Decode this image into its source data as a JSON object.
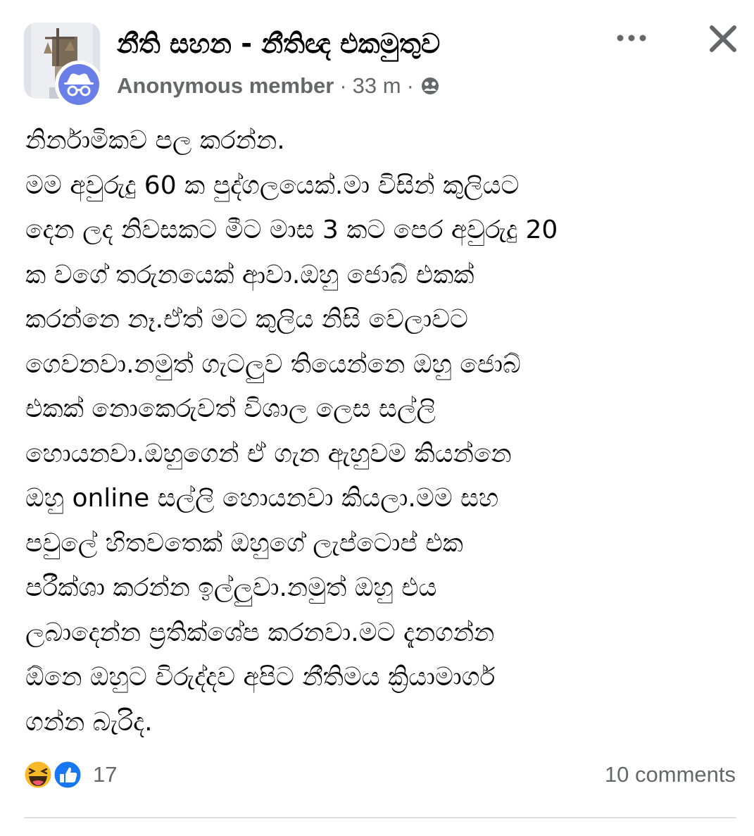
{
  "post": {
    "group_name": "නීති සහන -  නීතිඥ එකමුතුව",
    "author": "Anonymous member",
    "separator": "·",
    "time": "33 m",
    "body_lines": [
      "නිර්නාමිකව පල කරන්න.",
      "මම අවුරුදු 60 ක පුද්ගලයෙක්.මා විසින් කුලියට",
      "දෙන ලද නිවසකට මීට මාස 3 කට පෙර අවුරුදු 20",
      "ක වගේ තරුනයෙක් ආවා.ඔහු ජොබ් එකක්",
      "කරන්නෙ නෑ.ඒත් මට කුලිය නිසි වෙලාවට",
      "ගෙවනවා.නමුත් ගැටලුව තියෙන්නෙ ඔහු ජොබ්",
      "එකක් නොකෙරුවත් විශාල ලෙස සල්ලි",
      "හොයනවා.ඔහුගෙන් ඒ ගැන ඇහුවම කියන්නෙ",
      "ඔහු online සල්ලි හොයනවා කියලා.මම සහ",
      "පවුලේ හිතවතෙක් ඔහුගේ ලැප්ටොප් එක",
      "පරීක්ශා කරන්න ඉල්ලුවා.නමුත් ඔහු එය",
      "ලබාදෙන්න ප්‍රතික්ශේප කරනවා.මට දැනගන්න",
      "ඕනෙ ඔහුට විරුද්දව අපිට නීතිමය ක්‍රියාමාර්ග",
      "ගන්න බැරිද."
    ]
  },
  "reactions": {
    "count": "17",
    "types": [
      "haha-icon",
      "like-icon"
    ]
  },
  "comments_label": "10 comments",
  "colors": {
    "text_primary": "#050505",
    "text_secondary": "#65676b",
    "like_blue": "#1877f2",
    "haha_yellow": "#f7b928",
    "divider": "#dadde1"
  }
}
